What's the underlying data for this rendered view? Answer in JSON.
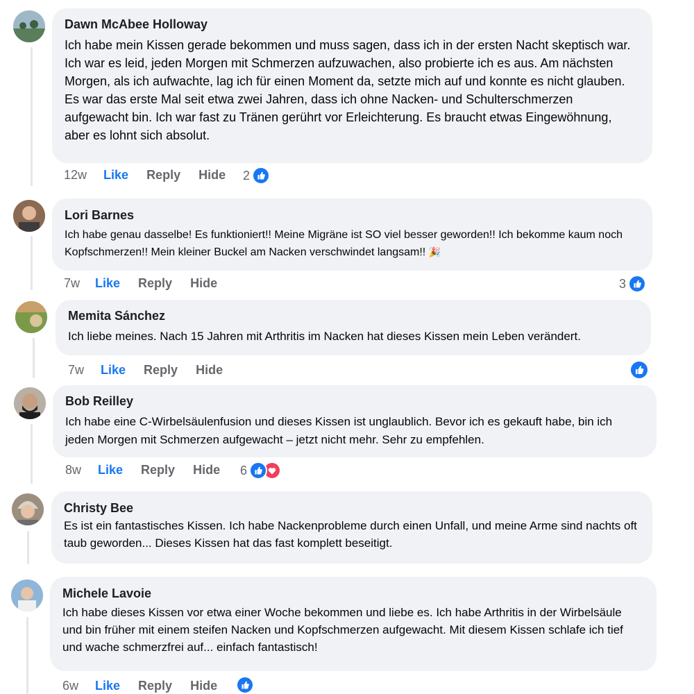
{
  "comments": [
    {
      "author": "Dawn McAbee Holloway",
      "text": "Ich habe mein Kissen gerade bekommen und muss sagen, dass ich in der ersten Nacht skeptisch war. Ich war es leid, jeden Morgen mit Schmerzen aufzuwachen, also probierte ich es aus. Am nächsten Morgen, als ich aufwachte, lag ich für einen Moment da, setzte mich auf und konnte es nicht glauben. Es war das erste Mal seit etwa zwei Jahren, dass ich ohne Nacken- und Schulterschmerzen aufgewacht bin. Ich war fast zu Tränen gerührt vor Erleichterung. Es braucht etwas Eingewöhnung, aber es lohnt sich absolut.",
      "time": "12w",
      "like": "Like",
      "reply": "Reply",
      "hide": "Hide",
      "reaction_count": "2",
      "reactions": [
        "like-icon"
      ]
    },
    {
      "author": "Lori Barnes",
      "text": "Ich habe genau dasselbe! Es funktioniert!! Meine Migräne ist SO viel besser geworden!! Ich bekomme kaum noch Kopfschmerzen!! Mein kleiner Buckel am Nacken verschwindet langsam!!",
      "emoji": "🎉",
      "time": "7w",
      "like": "Like",
      "reply": "Reply",
      "hide": "Hide",
      "reaction_count": "3",
      "reactions": [
        "like-icon"
      ]
    },
    {
      "author": "Memita Sánchez",
      "text": "Ich liebe meines. Nach 15 Jahren mit Arthritis im Nacken hat dieses Kissen mein Leben verändert.",
      "time": "7w",
      "like": "Like",
      "reply": "Reply",
      "hide": "Hide",
      "reaction_count": "",
      "reactions": [
        "like-icon"
      ]
    },
    {
      "author": "Bob Reilley",
      "text": "Ich habe eine C-Wirbelsäulenfusion und dieses Kissen ist unglaublich. Bevor ich es gekauft habe, bin ich jeden Morgen mit Schmerzen aufgewacht – jetzt nicht mehr. Sehr zu empfehlen.",
      "time": "8w",
      "like": "Like",
      "reply": "Reply",
      "hide": "Hide",
      "reaction_count": "6",
      "reactions": [
        "like-icon",
        "love-icon"
      ]
    },
    {
      "author": "Christy Bee",
      "text": "Es ist ein fantastisches Kissen. Ich habe Nackenprobleme durch einen Unfall, und meine Arme sind nachts oft taub geworden... Dieses Kissen hat das fast komplett beseitigt."
    },
    {
      "author": "Michele Lavoie",
      "text": "Ich habe dieses Kissen vor etwa einer Woche bekommen und liebe es. Ich habe Arthritis in der Wirbelsäule und bin früher mit einem steifen Nacken und Kopfschmerzen aufgewacht. Mit diesem Kissen schlafe ich tief und wache schmerzfrei auf... einfach fantastisch!",
      "time": "6w",
      "like": "Like",
      "reply": "Reply",
      "hide": "Hide",
      "reaction_count": "",
      "reactions": [
        "like-icon"
      ]
    }
  ],
  "colors": {
    "like_blue": "#1877f2",
    "love_red": "#f33e58",
    "bubble": "#f0f2f5",
    "meta_gray": "#65676b"
  }
}
